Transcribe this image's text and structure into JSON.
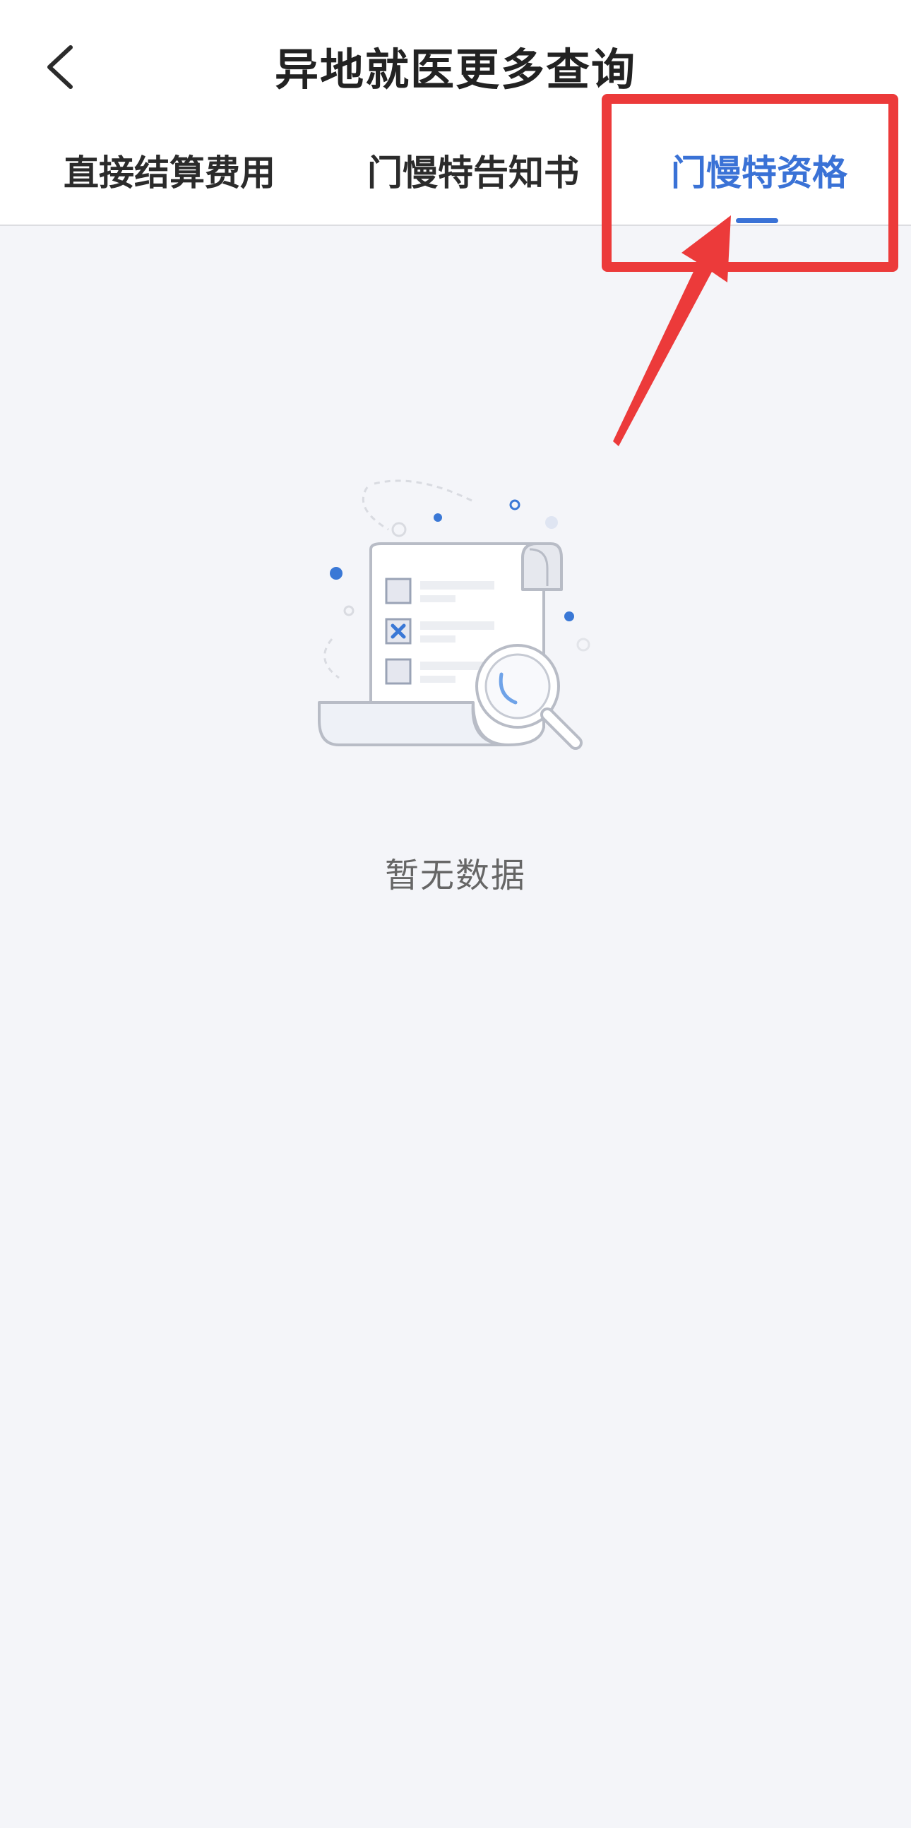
{
  "header": {
    "title": "异地就医更多查询",
    "back_icon": "chevron-left-icon"
  },
  "tabs": [
    {
      "label": "直接结算费用",
      "active": false
    },
    {
      "label": "门慢特告知书",
      "active": false
    },
    {
      "label": "门慢特资格",
      "active": true
    }
  ],
  "empty_state": {
    "icon": "document-search-illustration",
    "text": "暂无数据"
  },
  "colors": {
    "accent": "#3a72d6",
    "annotation": "#ec3a3a",
    "background": "#f4f5f9"
  }
}
